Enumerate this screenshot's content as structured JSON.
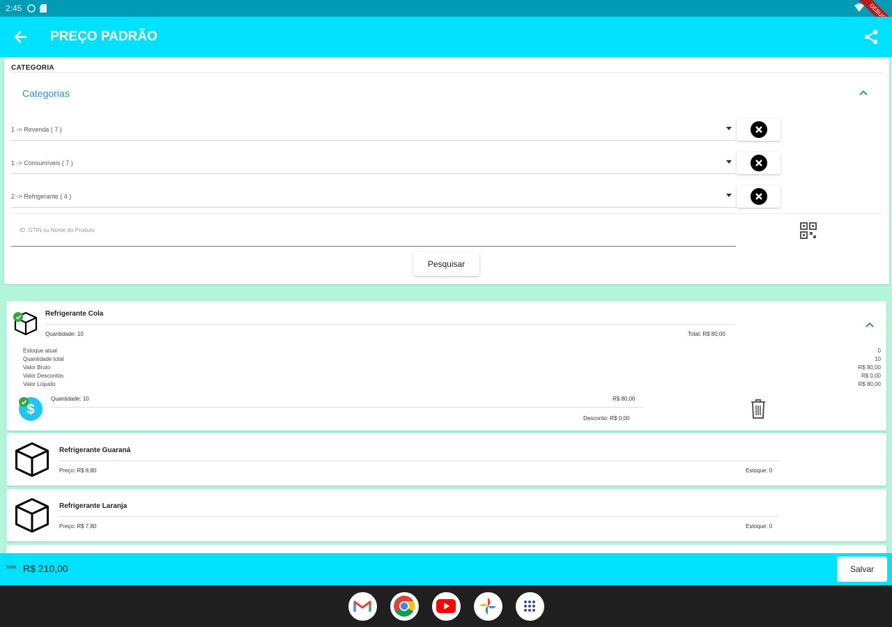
{
  "status_bar": {
    "time": "2:45"
  },
  "app_bar": {
    "title": "PREÇO PADRÃO"
  },
  "debug_banner": "DEBUG",
  "filter": {
    "heading": "CATEGORIA",
    "expander_label": "Categorias",
    "dropdowns": [
      {
        "value": "1 -> Revenda ( 7 )"
      },
      {
        "value": "1 -> Consumíveis ( 7 )"
      },
      {
        "value": "2 -> Refrigerante ( 4 )"
      }
    ],
    "search_placeholder": "ID, GTIN ou Nome do Produto",
    "search_button": "Pesquisar"
  },
  "products": {
    "expanded": {
      "name": "Refrigerante Cola",
      "quantity": "Quantidade: 10",
      "total": "Total: R$ 80,00",
      "stats": [
        {
          "label": "Estoque atual",
          "value": "0"
        },
        {
          "label": "Quantidade total",
          "value": "10"
        },
        {
          "label": "Valor Bruto",
          "value": "R$ 80,00"
        },
        {
          "label": "Valor Descontos",
          "value": "R$ 0,00"
        },
        {
          "label": "Valor Líquido",
          "value": "R$ 80,00"
        }
      ],
      "line_item": {
        "quantity": "Quantidade: 10",
        "value": "R$ 80,00",
        "discount": "Desconto: R$ 0,00"
      }
    },
    "list": [
      {
        "name": "Refrigerante Guaraná",
        "price": "Preço: R$ 8,80",
        "stock": "Estoque: 0"
      },
      {
        "name": "Refrigerante Laranja",
        "price": "Preço: R$ 7,80",
        "stock": "Estoque: 0"
      }
    ]
  },
  "footer": {
    "total_label": "Total",
    "total_value": "R$ 210,00",
    "save_button": "Salvar"
  },
  "dock": [
    "Gmail",
    "Chrome",
    "YouTube",
    "Photos",
    "Apps"
  ],
  "colors": {
    "app_bar": "#00e1fd",
    "background": "#b2f5da",
    "accent": "#2f8ae0",
    "status_bar": "#009bb5"
  }
}
